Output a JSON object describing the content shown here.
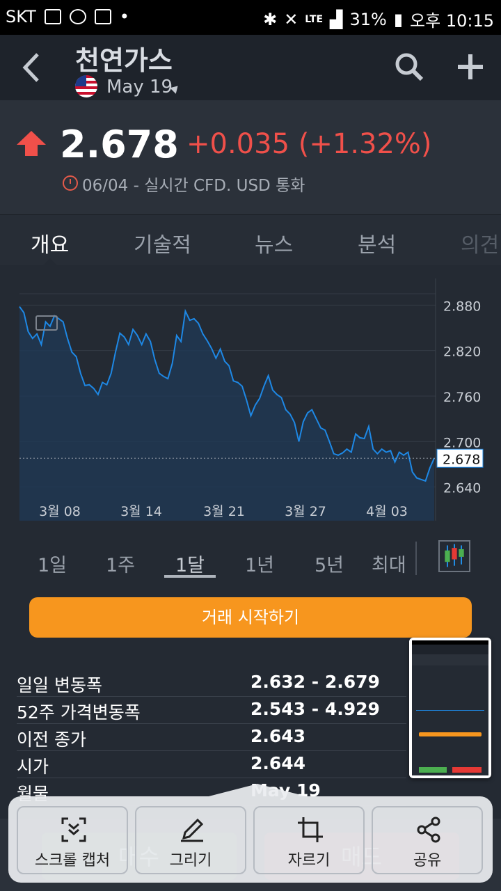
{
  "status_bar": {
    "carrier": "SKT",
    "network": "LTE",
    "battery": "31%",
    "time": "오후 10:15"
  },
  "header": {
    "title": "천연가스",
    "contract": "May 19"
  },
  "quote": {
    "price": "2.678",
    "change": "+0.035 (+1.32%)",
    "meta": "06/04 - 실시간 CFD. USD 통화"
  },
  "tabs": [
    "개요",
    "기술적",
    "뉴스",
    "분석",
    "의견"
  ],
  "chart_data": {
    "type": "area",
    "x_ticks": [
      "3월 08",
      "3월 14",
      "3월 21",
      "3월 27",
      "4월 03"
    ],
    "y_ticks": [
      "2.880",
      "2.820",
      "2.760",
      "2.700",
      "2.640"
    ],
    "ylim": [
      2.625,
      2.895
    ],
    "current_value": "2.678",
    "line_color": "#1e88e5",
    "values": [
      2.878,
      2.87,
      2.845,
      2.836,
      2.842,
      2.828,
      2.858,
      2.852,
      2.866,
      2.862,
      2.858,
      2.836,
      2.818,
      2.812,
      2.79,
      2.774,
      2.775,
      2.77,
      2.762,
      2.778,
      2.775,
      2.79,
      2.818,
      2.843,
      2.838,
      2.828,
      2.848,
      2.84,
      2.828,
      2.842,
      2.832,
      2.808,
      2.79,
      2.786,
      2.783,
      2.803,
      2.84,
      2.832,
      2.872,
      2.86,
      2.862,
      2.856,
      2.842,
      2.833,
      2.823,
      2.81,
      2.822,
      2.806,
      2.8,
      2.78,
      2.778,
      2.773,
      2.755,
      2.734,
      2.748,
      2.757,
      2.773,
      2.787,
      2.768,
      2.762,
      2.758,
      2.742,
      2.736,
      2.725,
      2.7,
      2.726,
      2.738,
      2.742,
      2.73,
      2.718,
      2.715,
      2.7,
      2.684,
      2.682,
      2.685,
      2.69,
      2.686,
      2.71,
      2.705,
      2.704,
      2.72,
      2.69,
      2.684,
      2.69,
      2.686,
      2.688,
      2.673,
      2.686,
      2.682,
      2.686,
      2.66,
      2.652,
      2.65,
      2.648,
      2.665,
      2.678
    ]
  },
  "ranges": [
    "1일",
    "1주",
    "1달",
    "1년",
    "5년",
    "최대"
  ],
  "trade_button": "거래 시작하기",
  "stats": [
    {
      "label": "일일 변동폭",
      "value": "2.632 - 2.679"
    },
    {
      "label": "52주 가격변동폭",
      "value": "2.543 - 4.929"
    },
    {
      "label": "이전 종가",
      "value": "2.643"
    },
    {
      "label": "시가",
      "value": "2.644"
    },
    {
      "label": "월물",
      "value": "May 19"
    }
  ],
  "ghost_buttons": {
    "buy": "매수",
    "sell": "매도"
  },
  "capture_toolbar": [
    "스크롤 캡처",
    "그리기",
    "자르기",
    "공유"
  ]
}
